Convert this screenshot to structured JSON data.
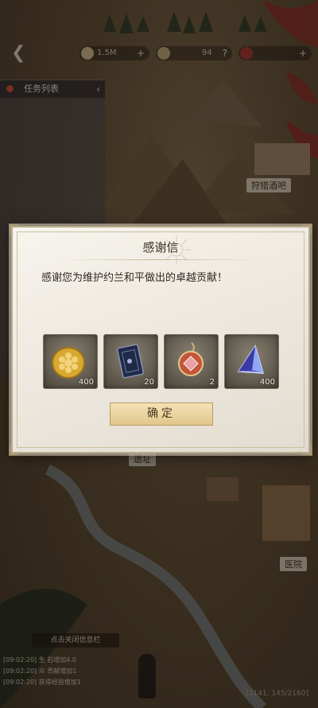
{
  "hud": {
    "currencies": [
      {
        "icon": "feather-quill-icon",
        "value": "1.5M"
      },
      {
        "icon": "leaf-token-icon",
        "value": "94"
      },
      {
        "icon": "red-crystal-icon",
        "value": ""
      }
    ]
  },
  "task_panel": {
    "title": "任务列表"
  },
  "map_labels": {
    "tavern": "狩猎酒吧",
    "ruins": "遗址",
    "hospital": "医院"
  },
  "chat": {
    "header": "点击关闭信息栏",
    "lines": [
      "[09:02:20] 生 石增加4.0",
      "[09:02:20] 众 贡献增加1",
      "[09:02:20] 获得经验增加1"
    ],
    "coords": "[2141, 145/2160]"
  },
  "modal": {
    "title": "感谢信",
    "message": "感谢您为维护约兰和平做出的卓越贡献！",
    "rewards": [
      {
        "icon": "gold-coin-icon",
        "qty": "400"
      },
      {
        "icon": "tarot-card-icon",
        "qty": "20"
      },
      {
        "icon": "red-amulet-icon",
        "qty": "2"
      },
      {
        "icon": "blue-crystal-icon",
        "qty": "400"
      }
    ],
    "confirm_label": "确定"
  },
  "colors": {
    "accent_gold": "#e2c68a",
    "panel_bg": "#f3efe7"
  }
}
